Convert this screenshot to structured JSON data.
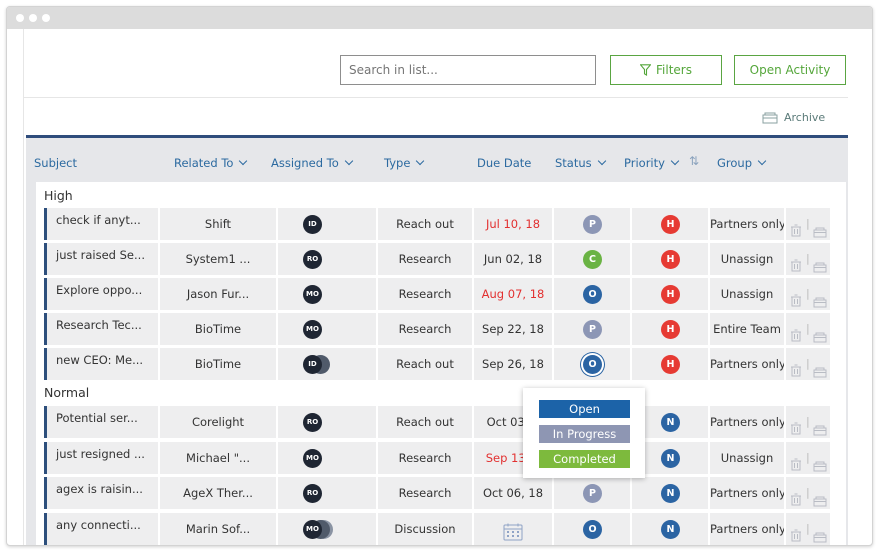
{
  "toolbar": {
    "search_placeholder": "Search in list...",
    "filters_label": "Filters",
    "open_activity_label": "Open Activity",
    "archive_label": "Archive"
  },
  "columns": {
    "subject": "Subject",
    "related_to": "Related To",
    "assigned_to": "Assigned To",
    "type": "Type",
    "due_date": "Due Date",
    "status": "Status",
    "priority": "Priority",
    "group": "Group"
  },
  "groups": [
    {
      "label": "High",
      "rows": [
        {
          "subject": "check if anyt...",
          "related": "Shift",
          "assigned": "ID",
          "type": "Reach out",
          "due": "Jul 10, 18",
          "overdue": true,
          "status": "P",
          "priority": "H",
          "group": "Partners only"
        },
        {
          "subject": "just raised Se...",
          "related": "System1 ...",
          "assigned": "RO",
          "type": "Research",
          "due": "Jun 02, 18",
          "overdue": false,
          "status": "C",
          "priority": "H",
          "group": "Unassign"
        },
        {
          "subject": "Explore oppo...",
          "related": "Jason Fur...",
          "assigned": "MO",
          "type": "Research",
          "due": "Aug 07, 18",
          "overdue": true,
          "status": "O",
          "priority": "H",
          "group": "Unassign"
        },
        {
          "subject": "Research Tec...",
          "related": "BioTime",
          "assigned": "MO",
          "type": "Research",
          "due": "Sep 22, 18",
          "overdue": false,
          "status": "P",
          "priority": "H",
          "group": "Entire Team"
        },
        {
          "subject": "new CEO: Me...",
          "related": "BioTime",
          "assigned": "ID",
          "type": "Reach out",
          "due": "Sep 26, 18",
          "overdue": false,
          "status": "O",
          "priority": "H",
          "group": "Partners only"
        }
      ]
    },
    {
      "label": "Normal",
      "rows": [
        {
          "subject": "Potential ser...",
          "related": "Corelight",
          "assigned": "RO",
          "type": "Reach out",
          "due": "Oct 03, 1",
          "overdue": false,
          "status": "",
          "priority": "N",
          "group": "Partners only"
        },
        {
          "subject": "just resigned ...",
          "related": "Michael \"...",
          "assigned": "MO",
          "type": "Research",
          "due": "Sep 13, 1",
          "overdue": true,
          "status": "",
          "priority": "N",
          "group": "Unassign"
        },
        {
          "subject": "agex is raisin...",
          "related": "AgeX Ther...",
          "assigned": "RO",
          "type": "Research",
          "due": "Oct 06, 18",
          "overdue": false,
          "status": "P",
          "priority": "N",
          "group": "Partners only"
        },
        {
          "subject": "any connecti...",
          "related": "Marin Sof...",
          "assigned": "MO",
          "type": "Discussion",
          "due": "",
          "overdue": false,
          "status": "O",
          "priority": "N",
          "group": "Partners only"
        }
      ]
    }
  ],
  "status_dropdown": {
    "options": [
      "Open",
      "In Progress",
      "Completed"
    ]
  },
  "colors": {
    "accent_green": "#54a63a",
    "header_blue": "#2c6aa0",
    "overdue_red": "#e23030",
    "priority_high": "#e63a33",
    "status_open": "#2b64a3",
    "status_completed": "#6ab344",
    "status_pending": "#8c96b5"
  }
}
